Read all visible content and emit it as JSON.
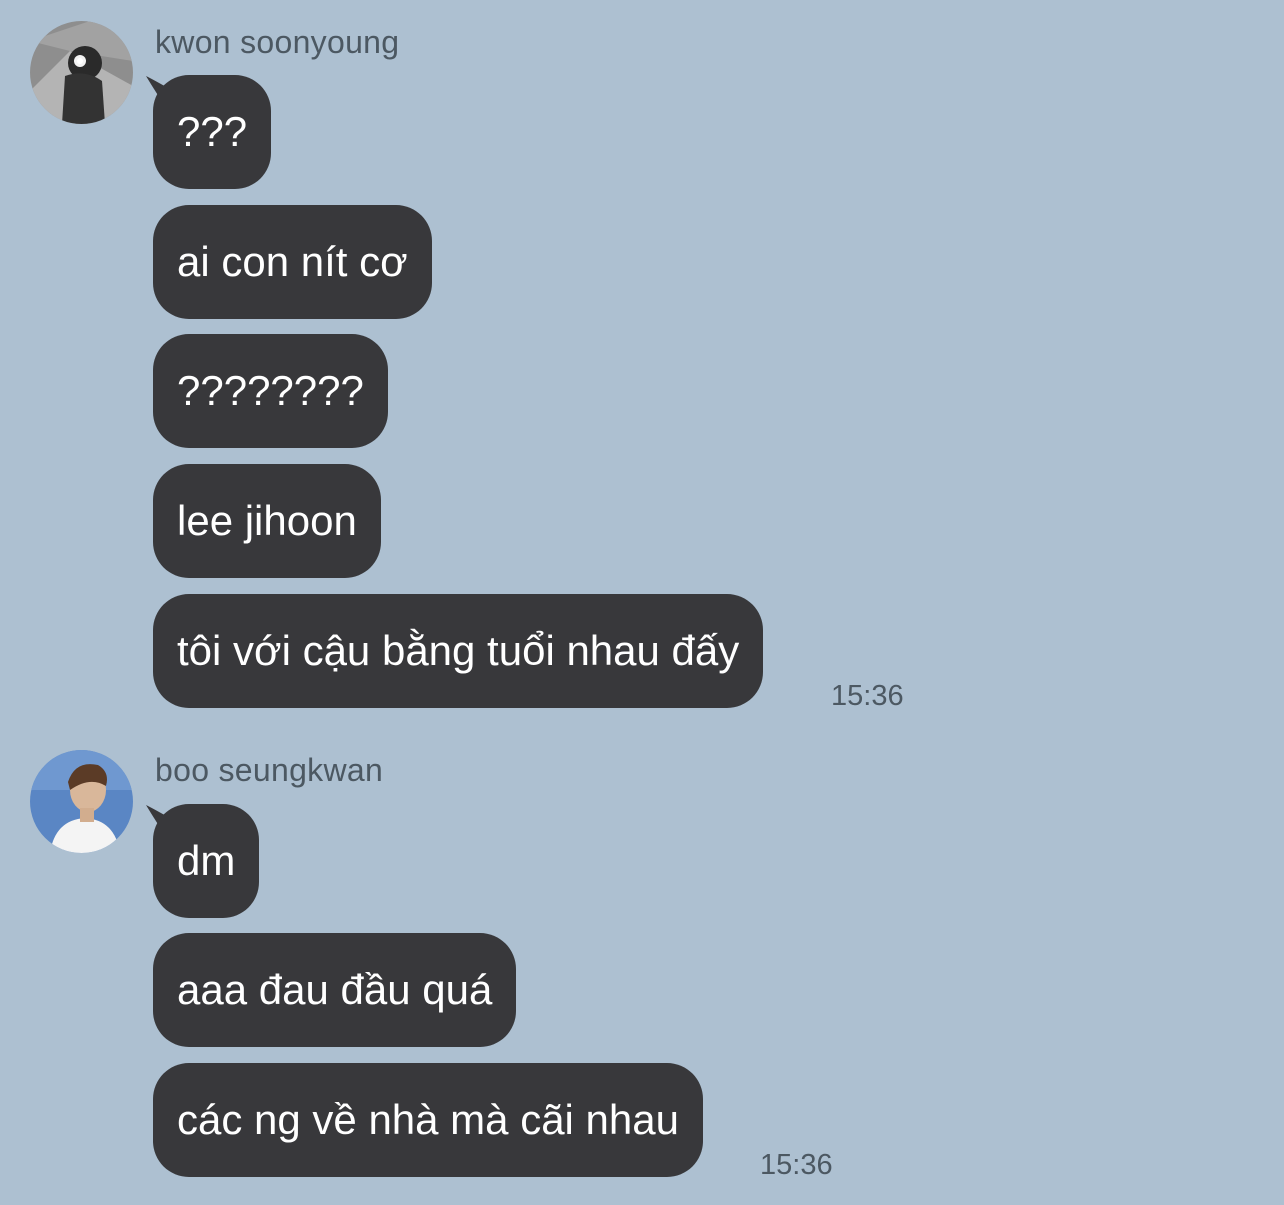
{
  "conversation": [
    {
      "sender": "kwon soonyoung",
      "avatar_icon": "profile-photo-kwon-soonyoung",
      "messages": [
        "???",
        "ai con nít cơ",
        "????????",
        "lee jihoon",
        "tôi với cậu bằng tuổi nhau đấy"
      ],
      "time": "15:36"
    },
    {
      "sender": "boo seungkwan",
      "avatar_icon": "profile-photo-boo-seungkwan",
      "messages": [
        "dm",
        "aaa đau đầu quá",
        "các ng về nhà mà cãi nhau"
      ],
      "time": "15:36"
    }
  ],
  "colors": {
    "background": "#adc0d1",
    "bubble": "#38383b",
    "bubble_text": "#ffffff",
    "meta_text": "#4c5862"
  }
}
